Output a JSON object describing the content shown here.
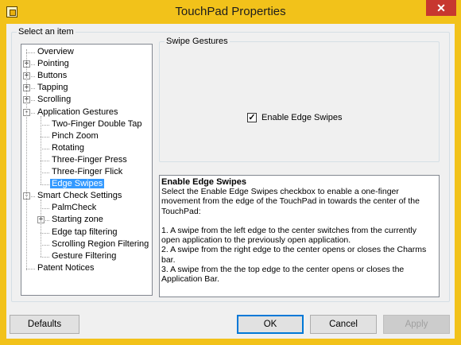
{
  "window": {
    "title": "TouchPad Properties",
    "close_glyph": "✕",
    "accent_color": "#f2c21a",
    "close_color": "#c7372f"
  },
  "select_group": {
    "legend": "Select an item"
  },
  "tree": {
    "items": [
      {
        "label": "Overview",
        "level": 0,
        "expander": ""
      },
      {
        "label": "Pointing",
        "level": 0,
        "expander": "+"
      },
      {
        "label": "Buttons",
        "level": 0,
        "expander": "+"
      },
      {
        "label": "Tapping",
        "level": 0,
        "expander": "+"
      },
      {
        "label": "Scrolling",
        "level": 0,
        "expander": "+"
      },
      {
        "label": "Application Gestures",
        "level": 0,
        "expander": "-"
      },
      {
        "label": "Two-Finger Double Tap",
        "level": 1,
        "expander": ""
      },
      {
        "label": "Pinch Zoom",
        "level": 1,
        "expander": ""
      },
      {
        "label": "Rotating",
        "level": 1,
        "expander": ""
      },
      {
        "label": "Three-Finger Press",
        "level": 1,
        "expander": ""
      },
      {
        "label": "Three-Finger Flick",
        "level": 1,
        "expander": ""
      },
      {
        "label": "Edge Swipes",
        "level": 1,
        "expander": "",
        "selected": true
      },
      {
        "label": "Smart Check Settings",
        "level": 0,
        "expander": "-"
      },
      {
        "label": "PalmCheck",
        "level": 1,
        "expander": ""
      },
      {
        "label": "Starting zone",
        "level": 1,
        "expander": "+"
      },
      {
        "label": "Edge tap filtering",
        "level": 1,
        "expander": ""
      },
      {
        "label": "Scrolling Region Filtering",
        "level": 1,
        "expander": ""
      },
      {
        "label": "Gesture Filtering",
        "level": 1,
        "expander": ""
      },
      {
        "label": "Patent Notices",
        "level": 0,
        "expander": ""
      }
    ]
  },
  "swipe_group": {
    "legend": "Swipe Gestures",
    "enable_label": "Enable Edge Swipes",
    "enable_checked": true,
    "check_glyph": "✓"
  },
  "description": {
    "title": "Enable Edge Swipes",
    "intro": "Select the Enable Edge Swipes checkbox to enable a one-finger movement from the edge of the TouchPad in towards the center of the TouchPad:",
    "item1": "1. A swipe from the left edge to the center switches from the currently open application to the previously open application.",
    "item2": "2. A swipe from the right edge to the center opens or closes the Charms bar.",
    "item3": "3. A swipe from the the top edge to the center opens or closes the Application Bar."
  },
  "buttons": {
    "defaults": "Defaults",
    "ok": "OK",
    "cancel": "Cancel",
    "apply": "Apply"
  }
}
